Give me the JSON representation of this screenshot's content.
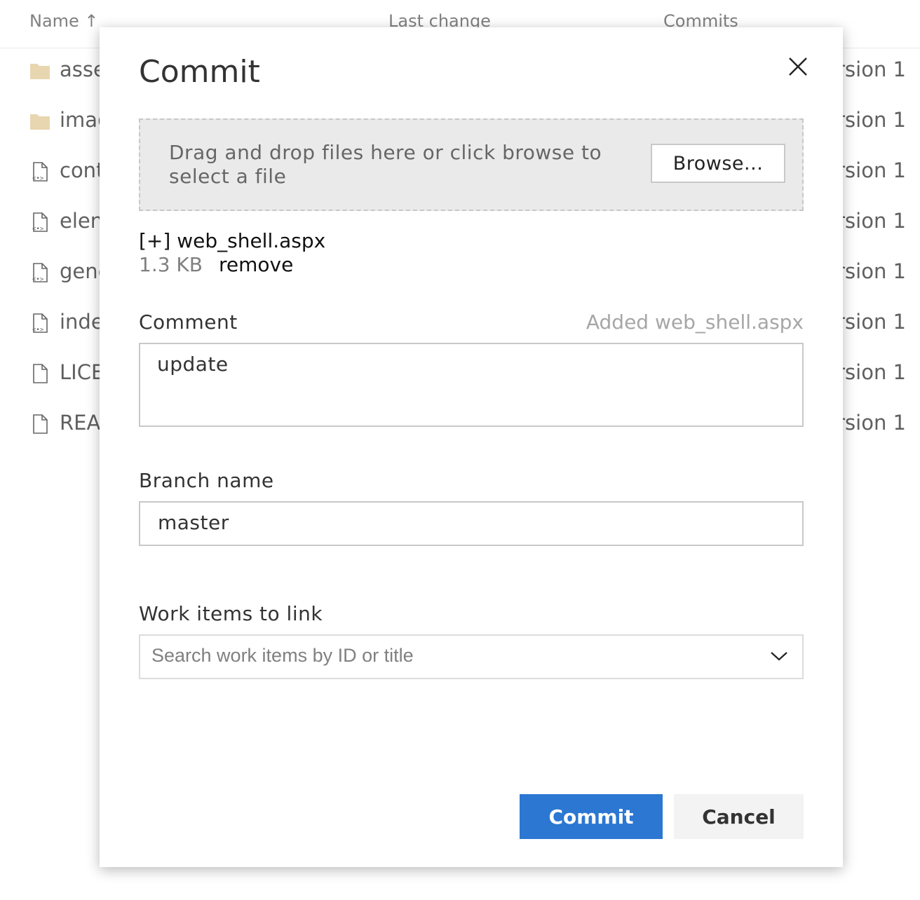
{
  "file_list": {
    "headers": {
      "name": "Name ↑",
      "last_change": "Last change",
      "commits": "Commits"
    },
    "rows": [
      {
        "name": "asse",
        "icon": "folder-icon",
        "commit": "rsion 1"
      },
      {
        "name": "imag",
        "icon": "folder-icon",
        "commit": "rsion 1"
      },
      {
        "name": "cont",
        "icon": "code-file-icon",
        "commit": "rsion 1"
      },
      {
        "name": "elen",
        "icon": "code-file-icon",
        "commit": "rsion 1"
      },
      {
        "name": "gene",
        "icon": "code-file-icon",
        "commit": "rsion 1"
      },
      {
        "name": "inde",
        "icon": "code-file-icon",
        "commit": "rsion 1"
      },
      {
        "name": "LICE",
        "icon": "file-icon",
        "commit": "rsion 1"
      },
      {
        "name": "REA",
        "icon": "file-icon",
        "commit": "rsion 1"
      }
    ]
  },
  "dialog": {
    "title": "Commit",
    "dropzone": {
      "text": "Drag and drop files here or click browse to select a file",
      "browse_label": "Browse..."
    },
    "file": {
      "name": "[+] web_shell.aspx",
      "size": "1.3 KB",
      "remove_label": "remove"
    },
    "comment": {
      "label": "Comment",
      "hint": "Added web_shell.aspx",
      "value": "update"
    },
    "branch": {
      "label": "Branch name",
      "value": "master"
    },
    "work_items": {
      "label": "Work items to link",
      "placeholder": "Search work items by ID or title"
    },
    "buttons": {
      "commit": "Commit",
      "cancel": "Cancel"
    }
  },
  "colors": {
    "accent": "#2b77d2",
    "folder": "#e8d6b0",
    "dropzone_bg": "#eaeaea"
  }
}
